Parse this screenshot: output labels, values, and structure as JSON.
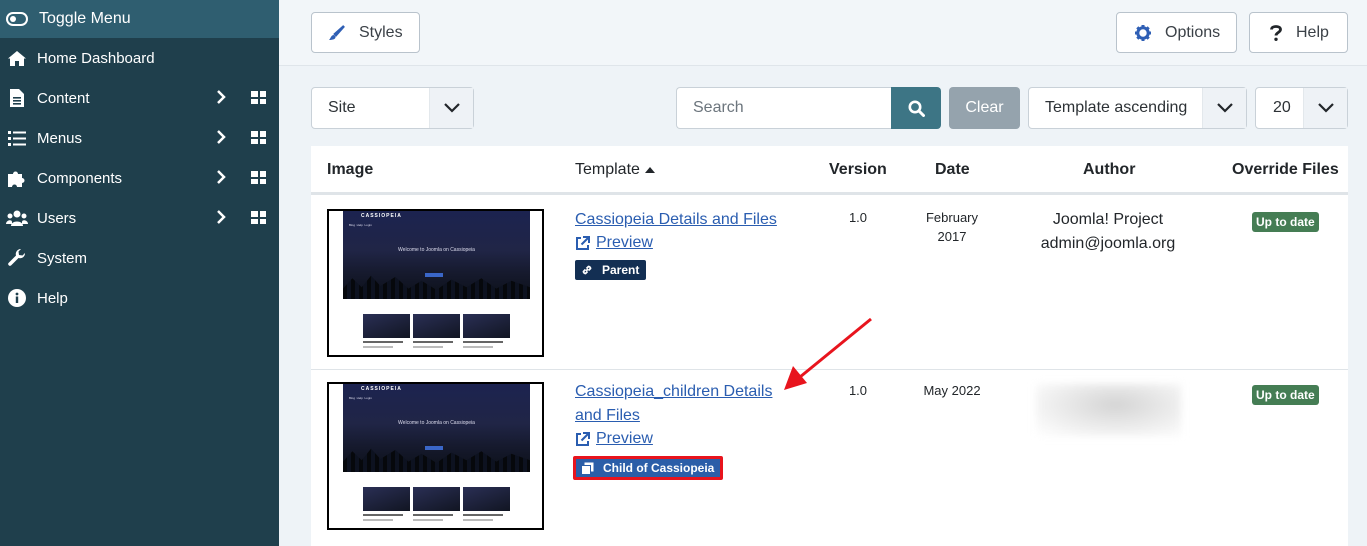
{
  "sidebar": {
    "toggle_label": "Toggle Menu",
    "items": [
      {
        "label": "Home Dashboard",
        "icon": "home-icon"
      },
      {
        "label": "Content",
        "icon": "file-icon"
      },
      {
        "label": "Menus",
        "icon": "list-icon"
      },
      {
        "label": "Components",
        "icon": "puzzle-icon"
      },
      {
        "label": "Users",
        "icon": "users-icon"
      },
      {
        "label": "System",
        "icon": "wrench-icon"
      },
      {
        "label": "Help",
        "icon": "info-icon"
      }
    ]
  },
  "toolbar": {
    "styles_label": "Styles",
    "options_label": "Options",
    "help_label": "Help"
  },
  "filters": {
    "client_value": "Site",
    "search_placeholder": "Search",
    "clear_label": "Clear",
    "ordering_value": "Template ascending",
    "limit_value": "20"
  },
  "table": {
    "columns": {
      "image": "Image",
      "template": "Template",
      "version": "Version",
      "date": "Date",
      "author": "Author",
      "override": "Override Files"
    },
    "rows": [
      {
        "title": "Cassiopeia Details and Files",
        "preview": "Preview",
        "badge": "Parent",
        "version": "1.0",
        "date_line1": "February",
        "date_line2": "2017",
        "author_name": "Joomla! Project",
        "author_email": "admin@joomla.org",
        "status": "Up to date"
      },
      {
        "title_line1": "Cassiopeia_children Details",
        "title_line2": "and Files",
        "preview": "Preview",
        "badge": "Child of Cassiopeia",
        "version": "1.0",
        "date": "May 2022",
        "status": "Up to date"
      }
    ]
  },
  "thumbnail": {
    "brand": "CASSIOPEIA",
    "welcome": "Welcome to Joomla on Cassiopeia"
  },
  "colors": {
    "sidebar_bg": "#1f3f4c",
    "accent": "#3d7585",
    "link": "#2a5db0",
    "badge_dark": "#132f53",
    "badge_success": "#457d54",
    "annotation_red": "#e8141d"
  }
}
